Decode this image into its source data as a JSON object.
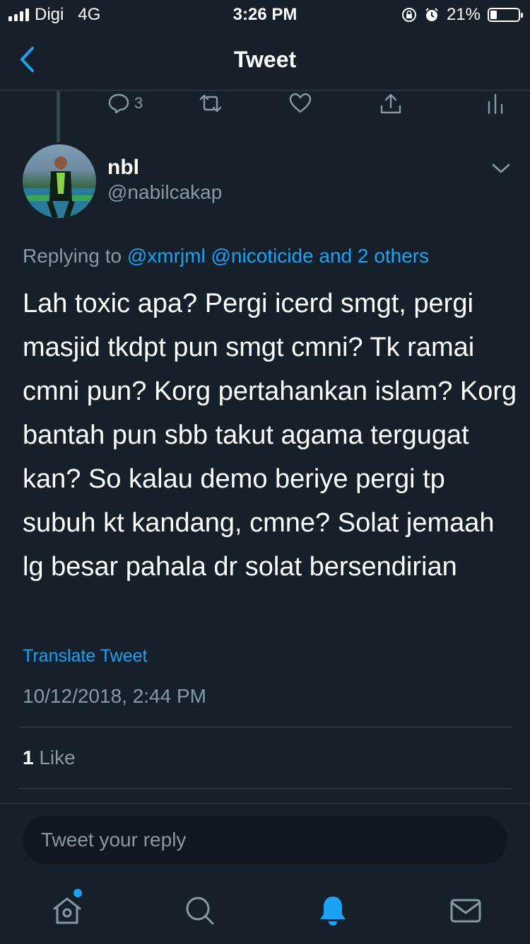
{
  "status_bar": {
    "carrier": "Digi",
    "network": "4G",
    "time": "3:26 PM",
    "battery": "21%"
  },
  "nav": {
    "title": "Tweet",
    "back_icon": "chevron-left-icon"
  },
  "parent_actions": {
    "reply_count": "3"
  },
  "tweet": {
    "author_name": "nbl",
    "author_handle": "@nabilcakap",
    "replying_prefix": "Replying to",
    "replying_to": "@xmrjml @nicoticide and 2 others",
    "text": "Lah toxic apa? Pergi icerd smgt, pergi masjid tkdpt pun smgt cmni? Tk ramai cmni pun? Korg pertahankan islam? Korg bantah pun sbb takut agama tergugat kan? So kalau demo beriye pergi tp subuh kt kandang, cmne? Solat jemaah lg besar pahala dr solat bersendirian",
    "translate_label": "Translate Tweet",
    "timestamp": "10/12/2018, 2:44 PM",
    "like_count": "1",
    "like_label": "Like"
  },
  "reply": {
    "placeholder": "Tweet your reply"
  },
  "colors": {
    "background": "#15202b",
    "accent": "#1da1f2",
    "secondary_text": "#8899a6",
    "divider": "#38444d"
  }
}
